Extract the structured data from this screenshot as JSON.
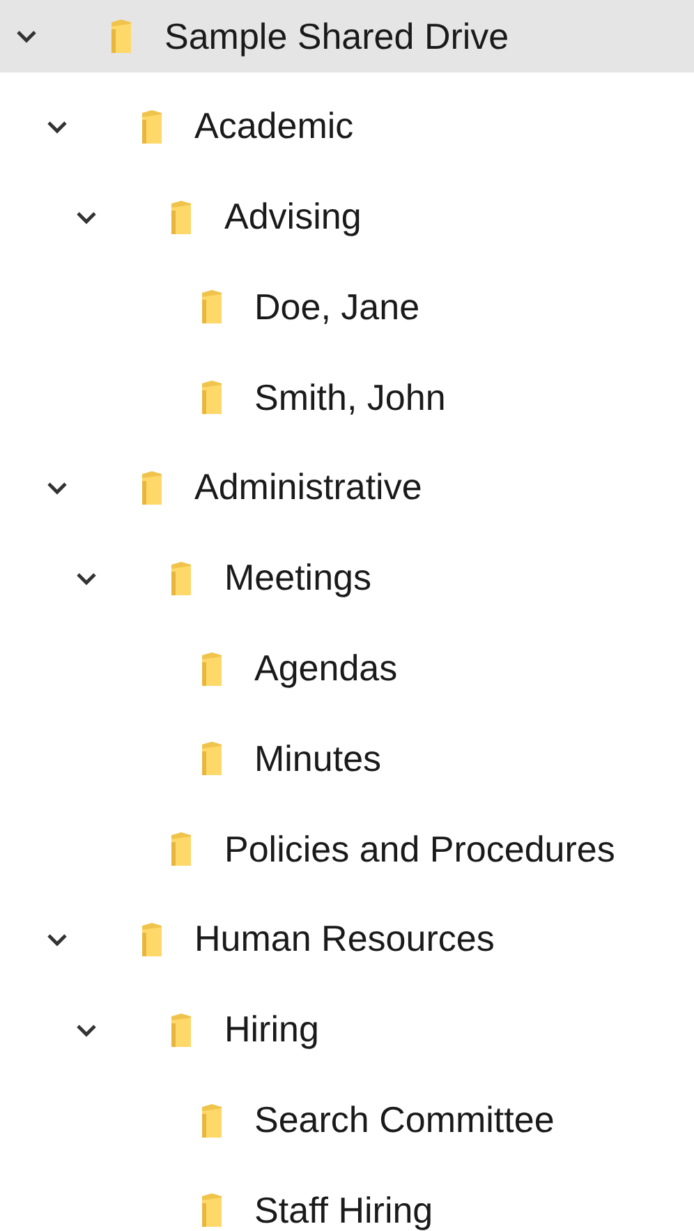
{
  "tree": [
    {
      "label": "Sample Shared Drive",
      "selected": true,
      "expanded": true,
      "children": [
        {
          "label": "Academic",
          "selected": false,
          "expanded": true,
          "children": [
            {
              "label": "Advising",
              "selected": false,
              "expanded": true,
              "children": [
                {
                  "label": "Doe, Jane",
                  "selected": false
                },
                {
                  "label": "Smith, John",
                  "selected": false
                }
              ]
            }
          ]
        },
        {
          "label": "Administrative",
          "selected": false,
          "expanded": true,
          "children": [
            {
              "label": "Meetings",
              "selected": false,
              "expanded": true,
              "children": [
                {
                  "label": "Agendas",
                  "selected": false
                },
                {
                  "label": "Minutes",
                  "selected": false
                }
              ]
            },
            {
              "label": "Policies and Procedures",
              "selected": false
            }
          ]
        },
        {
          "label": "Human Resources",
          "selected": false,
          "expanded": true,
          "children": [
            {
              "label": "Hiring",
              "selected": false,
              "expanded": true,
              "children": [
                {
                  "label": "Search Committee",
                  "selected": false
                },
                {
                  "label": "Staff Hiring",
                  "selected": false
                }
              ]
            }
          ]
        }
      ]
    }
  ]
}
